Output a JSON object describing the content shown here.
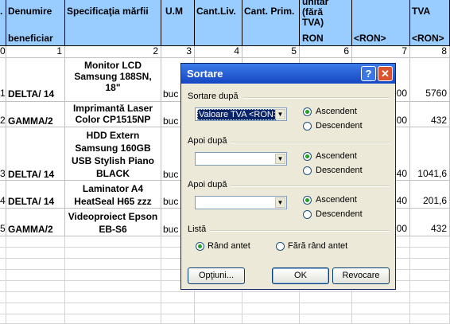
{
  "headers": {
    "col0": ".",
    "beneficiar_top": "Denumire",
    "beneficiar_bottom": "beneficiar",
    "spec": "Specificaţia mărfii",
    "um": "U.M",
    "cant_liv": "Cant.Liv.",
    "cant_prim": "Cant. Prim.",
    "unit_lines": [
      "unitar",
      "(fără",
      "TVA)",
      "RON"
    ],
    "val_ron": "<RON>",
    "tva": "TVA",
    "tva_ron": "<RON>"
  },
  "col_numbers": [
    "0",
    "1",
    "2",
    "3",
    "4",
    "5",
    "6",
    "7",
    "8"
  ],
  "rows": [
    {
      "nr": "1",
      "beneficiar": "DELTA/ 14",
      "spec": "Monitor LCD Samsung 188SN, 18\"",
      "um": "buc",
      "v7": "00",
      "tva": "5760"
    },
    {
      "nr": "2",
      "beneficiar": "GAMMA/2",
      "spec": "Imprimantă Laser Color CP1515NP",
      "um": "buc",
      "v7": "00",
      "tva": "432"
    },
    {
      "nr": "3",
      "beneficiar": "DELTA/ 14",
      "spec": "HDD Extern Samsung 160GB USB Stylish Piano BLACK",
      "um": "buc",
      "v7": "40",
      "tva": "1041,6"
    },
    {
      "nr": "4",
      "beneficiar": "DELTA/ 14",
      "spec": "Laminator A4 HeatSeal H65 zzz",
      "um": "buc",
      "v7": "40",
      "tva": "201,6"
    },
    {
      "nr": "5",
      "beneficiar": "GAMMA/2",
      "spec": "Videoproiect Epson EB-S6",
      "um": "buc",
      "v7": "00",
      "tva": "432"
    }
  ],
  "dialog": {
    "title": "Sortare",
    "help_glyph": "?",
    "close_glyph": "✕",
    "sort_by_label": "Sortare după",
    "sort_by_value": "Valoare TVA <RON>",
    "then_by_label": "Apoi după",
    "then_by2_label": "Apoi după",
    "ascending": "Ascendent",
    "descending": "Descendent",
    "list_label": "Listă",
    "header_row": "Rând antet",
    "no_header_row": "Fără rând antet",
    "options_btn": "Opţiuni...",
    "ok_btn": "OK",
    "cancel_btn": "Revocare"
  }
}
